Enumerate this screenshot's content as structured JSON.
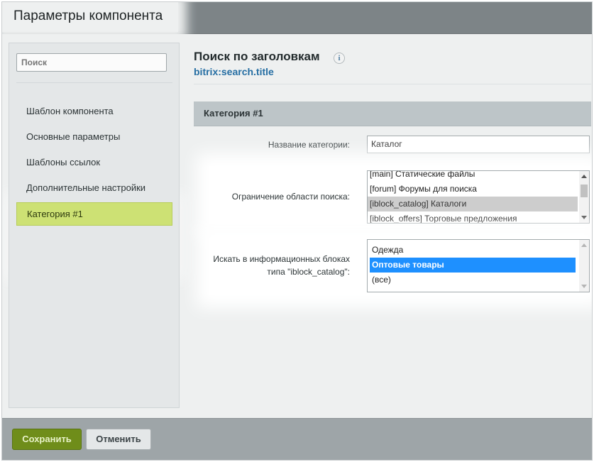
{
  "window": {
    "title": "Параметры компонента"
  },
  "sidebar": {
    "search_placeholder": "Поиск",
    "items": [
      {
        "label": "Шаблон компонента"
      },
      {
        "label": "Основные параметры"
      },
      {
        "label": "Шаблоны ссылок"
      },
      {
        "label": "Дополнительные настройки"
      },
      {
        "label": "Категория #1",
        "active": true
      }
    ]
  },
  "component": {
    "title": "Поиск по заголовкам",
    "info_icon": "i",
    "code": "bitrix:search.title"
  },
  "section": {
    "title": "Категория #1"
  },
  "fields": {
    "category_name": {
      "label": "Название категории:",
      "value": "Каталог"
    },
    "search_scope": {
      "label": "Ограничение области поиска:",
      "options": [
        "[main] Статические файлы",
        "[forum] Форумы для поиска",
        "[iblock_catalog] Каталоги",
        "[iblock_offers] Торговые предложения"
      ],
      "selected": "[iblock_catalog] Каталоги"
    },
    "iblocks": {
      "label_line1": "Искать в информационных блоках",
      "label_line2": "типа \"iblock_catalog\":",
      "options": [
        "Одежда",
        "Оптовые товары",
        "(все)"
      ],
      "selected": "Оптовые товары"
    }
  },
  "footer": {
    "save_label": "Сохранить",
    "cancel_label": "Отменить"
  },
  "colors": {
    "accent_green": "#cde174",
    "save_button": "#6f8d1a",
    "selection_blue": "#1e90ff"
  }
}
